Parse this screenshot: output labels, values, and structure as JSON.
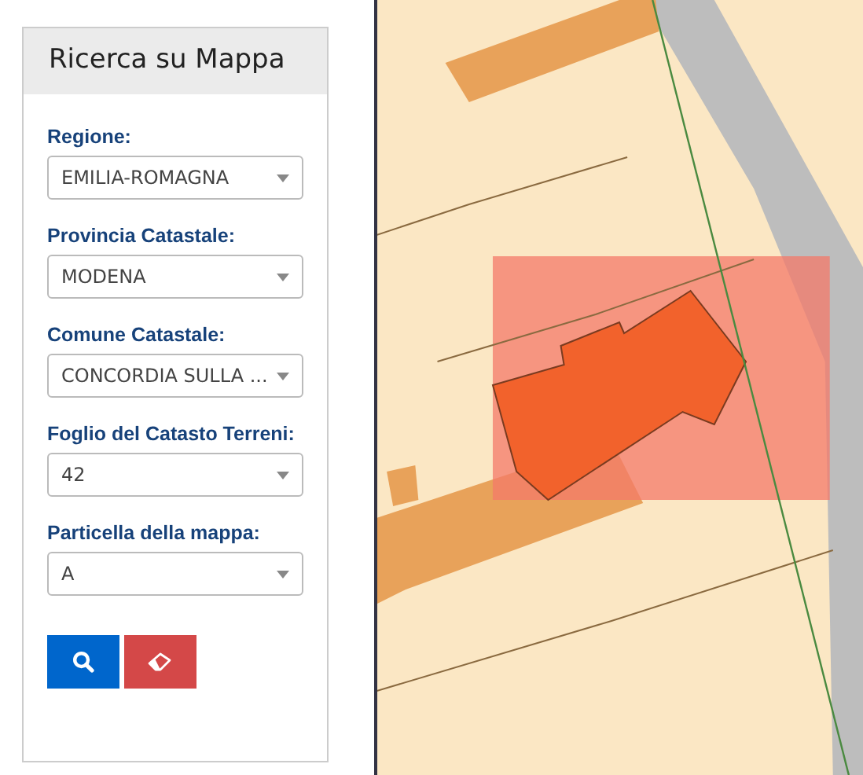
{
  "panel": {
    "title": "Ricerca su Mappa",
    "fields": [
      {
        "label": "Regione:",
        "value": "EMILIA-ROMAGNA"
      },
      {
        "label": "Provincia Catastale:",
        "value": "MODENA"
      },
      {
        "label": "Comune Catastale:",
        "value": "CONCORDIA SULLA ..."
      },
      {
        "label": "Foglio del Catasto Terreni:",
        "value": "42"
      },
      {
        "label": "Particella della mappa:",
        "value": "A"
      }
    ]
  }
}
